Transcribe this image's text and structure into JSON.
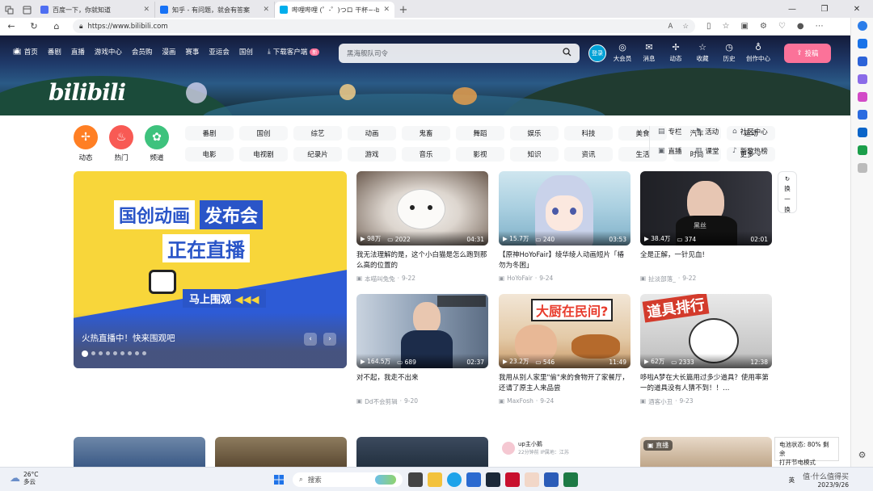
{
  "browser": {
    "tabs": [
      {
        "title": "百度一下，你就知道",
        "color": "#4e6ef2"
      },
      {
        "title": "知乎 - 有问题，就会有答案",
        "color": "#1772f6"
      },
      {
        "title": "哔哩哔哩 (゜-゜)つロ 干杯~-bilibili",
        "color": "#00aeec"
      }
    ],
    "url": "https://www.bilibili.com",
    "new_tab": "+"
  },
  "header": {
    "nav": [
      {
        "label": "首页",
        "icon": "tv-icon"
      },
      {
        "label": "番剧"
      },
      {
        "label": "直播"
      },
      {
        "label": "游戏中心"
      },
      {
        "label": "会员购"
      },
      {
        "label": "漫画"
      },
      {
        "label": "赛事"
      },
      {
        "label": "亚运会"
      },
      {
        "label": "国创"
      }
    ],
    "download": "下载客户端",
    "download_badge": "新",
    "search_placeholder": "黑海舰队司令",
    "login": "登录",
    "right": [
      "大会员",
      "消息",
      "动态",
      "收藏",
      "历史",
      "创作中心"
    ],
    "upload": "投稿",
    "logo": "bilibili"
  },
  "quick": [
    {
      "label": "动态",
      "color": "#ff7f24",
      "icon": "fan-icon"
    },
    {
      "label": "热门",
      "color": "#f85a54",
      "icon": "flame-icon"
    },
    {
      "label": "频道",
      "color": "#3ec27d",
      "icon": "channel-icon"
    }
  ],
  "channels": [
    "番剧",
    "国创",
    "综艺",
    "动画",
    "鬼畜",
    "舞蹈",
    "娱乐",
    "科技",
    "美食",
    "汽车",
    "运动",
    "电影",
    "电视剧",
    "纪录片",
    "游戏",
    "音乐",
    "影视",
    "知识",
    "资讯",
    "生活",
    "时尚",
    "更多"
  ],
  "extra": [
    "专栏",
    "活动",
    "社区中心",
    "直播",
    "课堂",
    "新歌热榜"
  ],
  "carousel": {
    "line1a": "国创动画",
    "line1b": "发布会",
    "line2": "正在直播",
    "cta": "马上围观",
    "caption": "火热直播中！快来围观吧",
    "prev": "‹",
    "next": "›"
  },
  "refresh": {
    "a": "换",
    "b": "一",
    "c": "换"
  },
  "videos": [
    {
      "views": "98万",
      "danmaku": "2022",
      "duration": "04:31",
      "title": "我无法理解的是，这个小白猫是怎么跑到那么高的位置的",
      "up": "本喵叫兔兔",
      "date": "9-22"
    },
    {
      "views": "15.7万",
      "danmaku": "240",
      "duration": "03:53",
      "title": "【原神HoYoFair】绫华绫人动画短片「椿勿为冬困」",
      "up": "HoYoFair",
      "date": "9-24"
    },
    {
      "views": "38.4万",
      "danmaku": "374",
      "duration": "02:01",
      "title": "全是正解，一针见血!",
      "up": "扯淡部落_",
      "date": "9-22"
    },
    {
      "views": "164.5万",
      "danmaku": "689",
      "duration": "02:37",
      "title": "对不起，我走不出来",
      "up": "Dd不会剪辑",
      "date": "9-20"
    },
    {
      "views": "23.2万",
      "danmaku": "546",
      "duration": "11:49",
      "title": "我用从别人家里\"偷\"来的食物开了家餐厅，还请了原主人来品尝",
      "up": "MaxFosh",
      "date": "9-24"
    },
    {
      "views": "62万",
      "danmaku": "2333",
      "duration": "12:38",
      "title": "哆啦A梦在大长篇用过多少道具？使用率第一的道具没有人猜不到！！…",
      "up": "酒客小丑",
      "date": "9-23"
    }
  ],
  "thumb_text": {
    "v4": "大厨在民间?",
    "v5": "道具排行",
    "v5b": "黑丝"
  },
  "bottom": {
    "up_label": "up主小鹅",
    "up_meta": "22分钟前  IP属地：江苏",
    "live": "直播"
  },
  "notice": {
    "line1": "电池状态: 80% 剩余",
    "line2": "打开节电模式"
  },
  "taskbar": {
    "temp": "26°C",
    "weather": "多云",
    "search": "搜索",
    "ime": "英",
    "date": "2023/9/26",
    "watermark": "值·什么值得买"
  }
}
